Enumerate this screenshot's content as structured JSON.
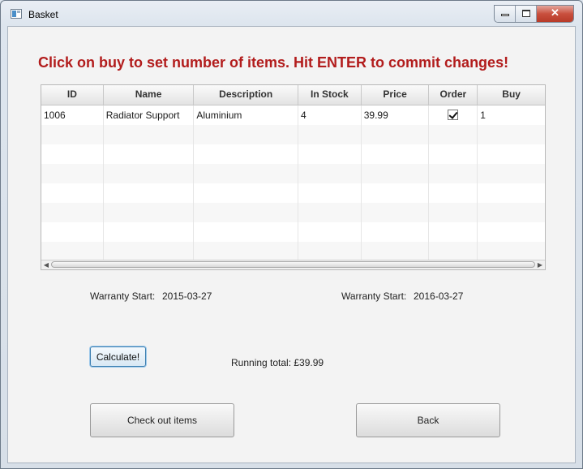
{
  "window": {
    "title": "Basket",
    "controls": {
      "minimize": "minimize-icon",
      "maximize": "maximize-icon",
      "close": "✕"
    }
  },
  "headline": "Click on buy to set number of items. Hit ENTER to commit changes!",
  "table": {
    "columns": [
      "ID",
      "Name",
      "Description",
      "In Stock",
      "Price",
      "Order",
      "Buy"
    ],
    "rows": [
      {
        "id": "1006",
        "name": "Radiator Support",
        "description": "Aluminium",
        "in_stock": "4",
        "price": "39.99",
        "order": true,
        "buy": "1"
      }
    ],
    "empty_rows": 7
  },
  "warranty": {
    "start_label": "Warranty Start:",
    "start_value": "2015-03-27",
    "end_label": "Warranty Start:",
    "end_value": "2016-03-27"
  },
  "actions": {
    "calculate": "Calculate!",
    "running_total": "Running total: £39.99",
    "checkout": "Check out items",
    "back": "Back"
  }
}
